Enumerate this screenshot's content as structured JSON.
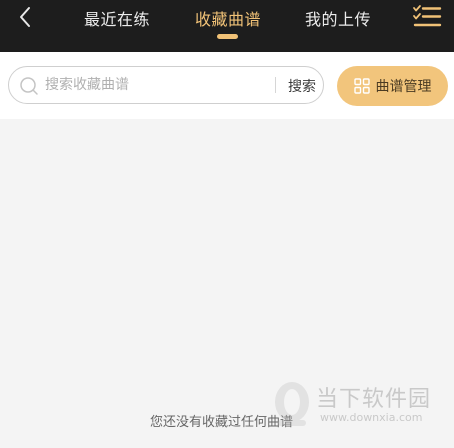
{
  "header": {
    "tabs": [
      {
        "label": "最近在练",
        "active": false
      },
      {
        "label": "收藏曲谱",
        "active": true
      },
      {
        "label": "我的上传",
        "active": false
      }
    ]
  },
  "search": {
    "placeholder": "搜索收藏曲谱",
    "value": "",
    "button_label": "搜索"
  },
  "manage_button": {
    "label": "曲谱管理"
  },
  "empty_state": {
    "message": "您还没有收藏过任何曲谱"
  },
  "watermark": {
    "title": "当下软件园",
    "url": "www.downxia.com"
  },
  "colors": {
    "header_bg": "#1d1d1d",
    "accent": "#f1c277",
    "manage_button_bg": "#f2c57c",
    "page_bg": "#f4f4f4"
  }
}
